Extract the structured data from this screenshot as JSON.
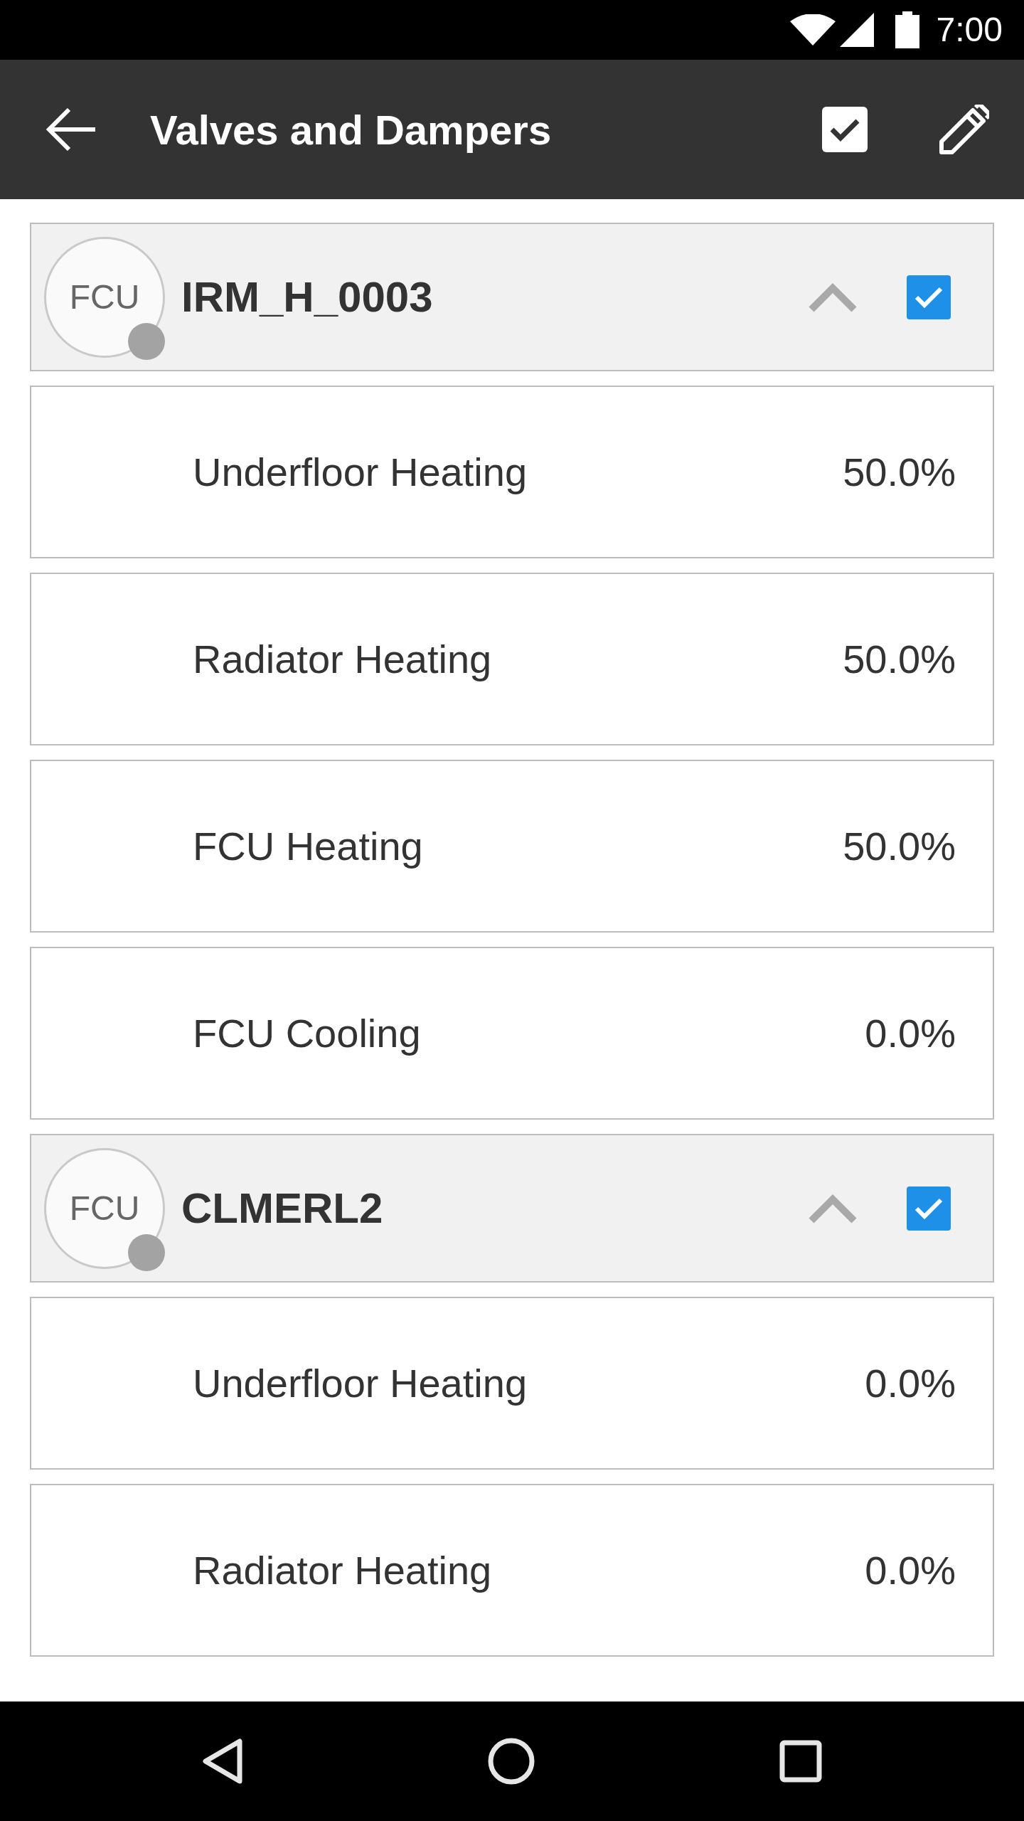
{
  "status_bar": {
    "time": "7:00"
  },
  "app_bar": {
    "title": "Valves and Dampers"
  },
  "groups": [
    {
      "badge": "FCU",
      "name": "IRM_H_0003",
      "expanded": true,
      "checked": true,
      "items": [
        {
          "label": "Underfloor Heating",
          "value": "50.0%"
        },
        {
          "label": "Radiator Heating",
          "value": "50.0%"
        },
        {
          "label": "FCU Heating",
          "value": "50.0%"
        },
        {
          "label": "FCU Cooling",
          "value": "0.0%"
        }
      ]
    },
    {
      "badge": "FCU",
      "name": "CLMERL2",
      "expanded": true,
      "checked": true,
      "items": [
        {
          "label": "Underfloor Heating",
          "value": "0.0%"
        },
        {
          "label": "Radiator Heating",
          "value": "0.0%"
        }
      ]
    }
  ]
}
